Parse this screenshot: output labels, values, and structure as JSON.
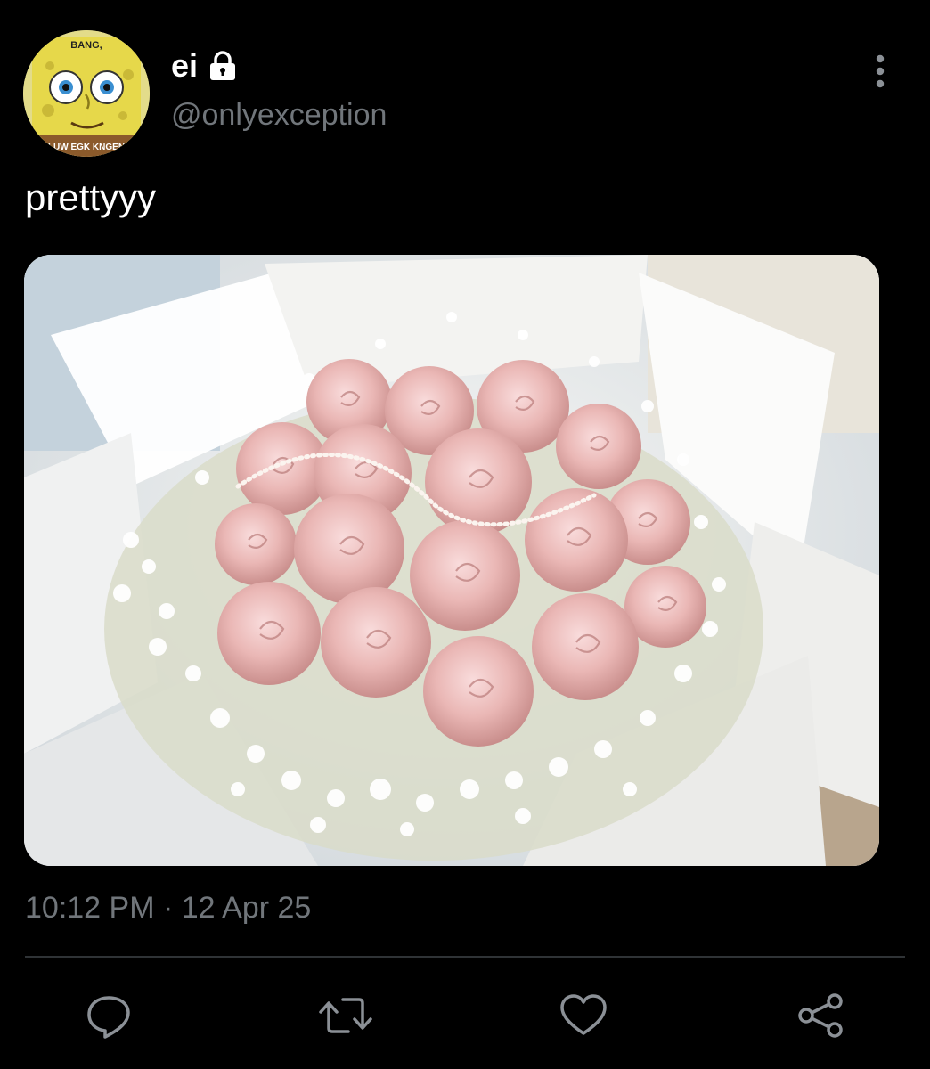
{
  "tweet": {
    "display_name": "ei",
    "handle": "@onlyexception",
    "text": "prettyyy",
    "time": "10:12 PM",
    "separator": "·",
    "date": "12 Apr 25",
    "avatar": {
      "top_caption": "BANG,",
      "bottom_caption": "LUW EGK KNGEN"
    },
    "image_description_icon": "bouquet-photo"
  },
  "icons": {
    "lock": "lock-icon",
    "more": "more-vertical-icon",
    "reply": "reply-icon",
    "retweet": "retweet-icon",
    "like": "heart-icon",
    "share": "share-icon"
  },
  "colors": {
    "background": "#000000",
    "primary_text": "#ffffff",
    "secondary_text": "#71767b",
    "divider": "#2f3336"
  }
}
